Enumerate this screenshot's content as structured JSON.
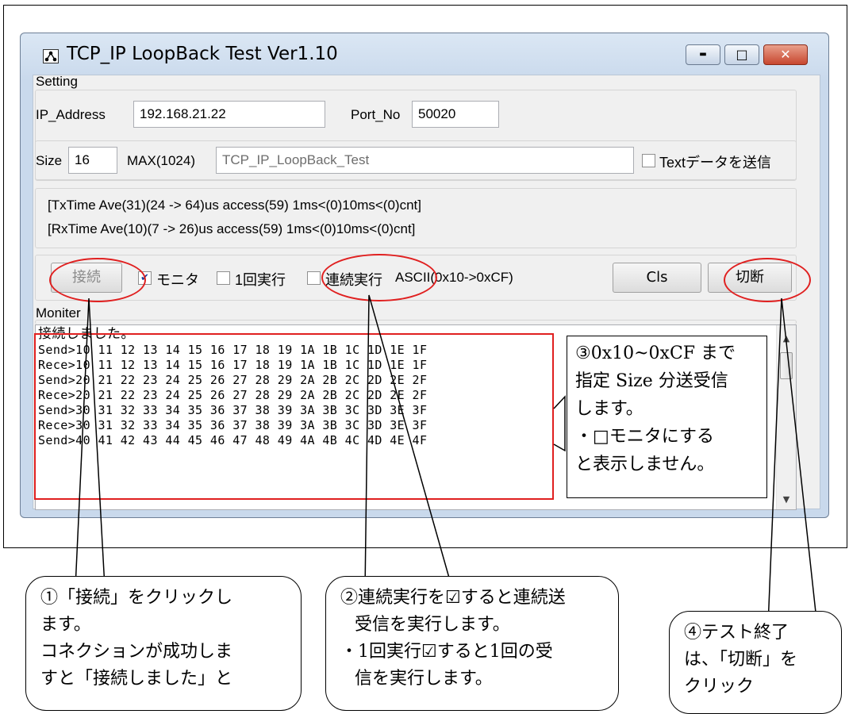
{
  "window": {
    "title": "TCP_IP LoopBack Test Ver1.10",
    "min_symbol": "▬",
    "max_symbol": "□",
    "close_symbol": "✕"
  },
  "setting": {
    "group_label": "Setting",
    "ip_label": "IP_Address",
    "ip_value": "192.168.21.22",
    "port_label": "Port_No",
    "port_value": "50020",
    "size_label": "Size",
    "size_value": "16",
    "max_label": "MAX(1024)",
    "text_value": "TCP_IP_LoopBack_Test",
    "send_text_label": "Textデータを送信",
    "send_text_checked": false
  },
  "stats": {
    "tx": "[TxTime Ave(31)(24 -> 64)us access(59) 1ms<(0)10ms<(0)cnt]",
    "rx": "[RxTime Ave(10)(7 -> 26)us access(59) 1ms<(0)10ms<(0)cnt]"
  },
  "controls": {
    "connect_label": "接続",
    "monitor_label": "モニタ",
    "monitor_checked": true,
    "once_label": "1回実行",
    "once_checked": false,
    "continuous_label": "連続実行",
    "continuous_checked": false,
    "ascii_label": "ASCII(0x10->0xCF)",
    "cls_label": "Cls",
    "disconnect_label": "切断"
  },
  "monitor": {
    "group_label": "Moniter",
    "lines": [
      "接続しました。",
      "Send>10 11 12 13 14 15 16 17 18 19 1A 1B 1C 1D 1E 1F",
      "Rece>10 11 12 13 14 15 16 17 18 19 1A 1B 1C 1D 1E 1F",
      "Send>20 21 22 23 24 25 26 27 28 29 2A 2B 2C 2D 2E 2F",
      "Rece>20 21 22 23 24 25 26 27 28 29 2A 2B 2C 2D 2E 2F",
      "Send>30 31 32 33 34 35 36 37 38 39 3A 3B 3C 3D 3E 3F",
      "Rece>30 31 32 33 34 35 36 37 38 39 3A 3B 3C 3D 3E 3F",
      "Send>40 41 42 43 44 45 46 47 48 49 4A 4B 4C 4D 4E 4F"
    ]
  },
  "annotations": {
    "note3": [
      "③0x10~0xCF まで",
      "指定 Size 分送受信",
      "します。",
      "・□モニタにする",
      "と表示しません。"
    ],
    "callout1": [
      "①「接続」をクリックし",
      "ます。",
      "コネクションが成功しま",
      "すと「接続しました」と"
    ],
    "callout2": [
      "②連続実行を☑すると連続送",
      "受信を実行します。",
      "・1回実行☑すると1回の受",
      "信を実行します。"
    ],
    "callout4": [
      "④テスト終了",
      "は、「切断」を",
      "クリック"
    ]
  },
  "colors": {
    "highlight": "#e02020"
  }
}
